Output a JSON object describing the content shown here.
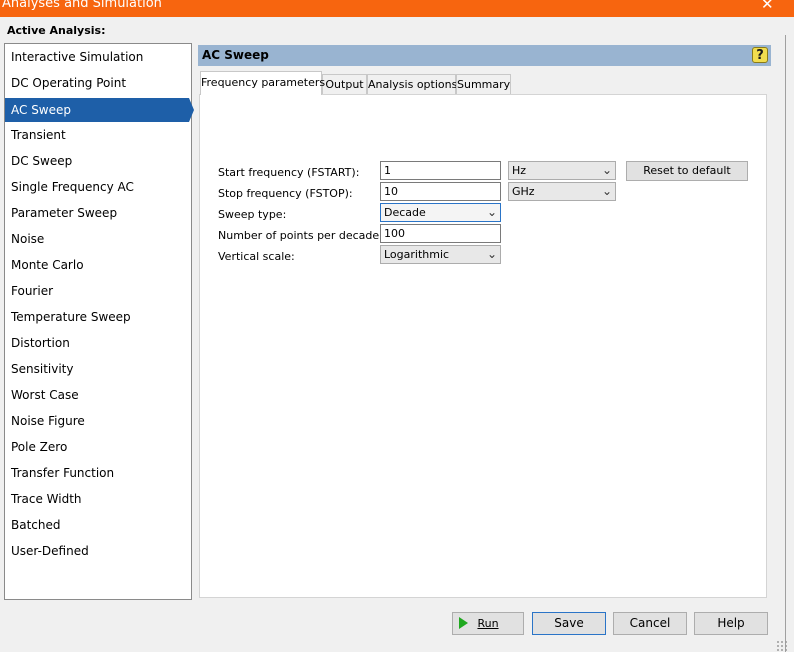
{
  "window": {
    "title": "Analyses and Simulation",
    "close_glyph": "✕",
    "title_bar_color": "#f7650f"
  },
  "active_analysis_label": "Active Analysis:",
  "analyses": [
    "Interactive Simulation",
    "DC Operating Point",
    "AC Sweep",
    "Transient",
    "DC Sweep",
    "Single Frequency AC",
    "Parameter Sweep",
    "Noise",
    "Monte Carlo",
    "Fourier",
    "Temperature Sweep",
    "Distortion",
    "Sensitivity",
    "Worst Case",
    "Noise Figure",
    "Pole Zero",
    "Transfer Function",
    "Trace Width",
    "Batched",
    "User-Defined"
  ],
  "selected_analysis": "AC Sweep",
  "panel": {
    "title": "AC Sweep",
    "help_icon": "help-icon",
    "help_glyph": "?"
  },
  "tabs": [
    "Frequency parameters",
    "Output",
    "Analysis options",
    "Summary"
  ],
  "active_tab": "Frequency parameters",
  "form": {
    "start_freq_label": "Start frequency (FSTART):",
    "start_freq_value": "1",
    "start_freq_unit": "Hz",
    "stop_freq_label": "Stop frequency (FSTOP):",
    "stop_freq_value": "10",
    "stop_freq_unit": "GHz",
    "sweep_type_label": "Sweep type:",
    "sweep_type_value": "Decade",
    "points_label": "Number of points per decade:",
    "points_value": "100",
    "vertical_scale_label": "Vertical scale:",
    "vertical_scale_value": "Logarithmic",
    "reset_label": "Reset to default"
  },
  "buttons": {
    "run": "Run",
    "save": "Save",
    "cancel": "Cancel",
    "help": "Help"
  },
  "colors": {
    "selection": "#1e5fa8",
    "header_bar": "#99b4d1",
    "run_icon": "#1fa81f"
  },
  "chevron_glyph": "⌄"
}
